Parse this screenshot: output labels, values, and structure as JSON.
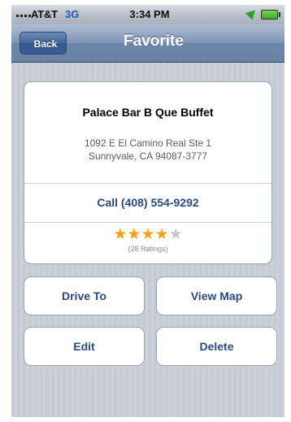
{
  "status_bar": {
    "carrier": "AT&T",
    "network": "3G",
    "time": "3:34 PM"
  },
  "nav": {
    "back_label": "Back",
    "title": "Favorite"
  },
  "place": {
    "name": "Palace Bar B Que Buffet",
    "address_line_1": "1092 E El Camino Real Ste 1",
    "address_line_2": "Sunnyvale, CA 94087-3777",
    "call_label": "Call (408) 554-9292",
    "rating": 4,
    "rating_max": 5,
    "rating_count": "(28 Ratings)"
  },
  "actions": {
    "drive_to": "Drive To",
    "view_map": "View Map",
    "edit": "Edit",
    "delete": "Delete"
  },
  "colors": {
    "nav_bar": "#7d94b4",
    "link_text": "#2a4a80",
    "star_filled": "#f5a010",
    "star_empty": "#c8c8c8",
    "background": "#c5ccd4"
  }
}
